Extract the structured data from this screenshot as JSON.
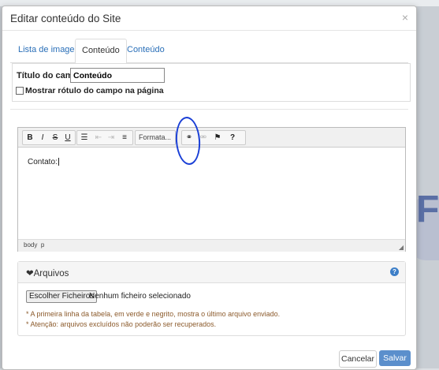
{
  "modal": {
    "title": "Editar conteúdo do Site",
    "close": "×"
  },
  "tabs": [
    {
      "label": "Lista de imagens"
    },
    {
      "label": "Conteúdo",
      "active": true
    },
    {
      "label": "Conteúdo"
    }
  ],
  "field": {
    "label": "Título do campo:",
    "value": "Conteúdo",
    "show_label_checkbox": "Mostrar rótulo do campo na página",
    "show_label_checked": false
  },
  "editor": {
    "toolbar": {
      "bold": "B",
      "italic": "I",
      "strike": "S",
      "underline": "U",
      "format": "Formata...",
      "help": "?"
    },
    "content": "Contato:",
    "status_path": [
      "body",
      "p"
    ]
  },
  "files_panel": {
    "title": "❤Arquivos",
    "choose_button": "Escolher Ficheiros",
    "file_status": "Nenhum ficheiro selecionado",
    "note1": "* A primeira linha da tabela, em verde e negrito, mostra o último arquivo enviado.",
    "note2": "* Atenção: arquivos excluídos não poderão ser recuperados."
  },
  "footer": {
    "cancel": "Cancelar",
    "save": "Salvar"
  },
  "colors": {
    "link": "#2a6fb8",
    "save_button": "#5b8fcc",
    "annotation": "#1a3fd6",
    "note_text": "#8b5a2b"
  }
}
